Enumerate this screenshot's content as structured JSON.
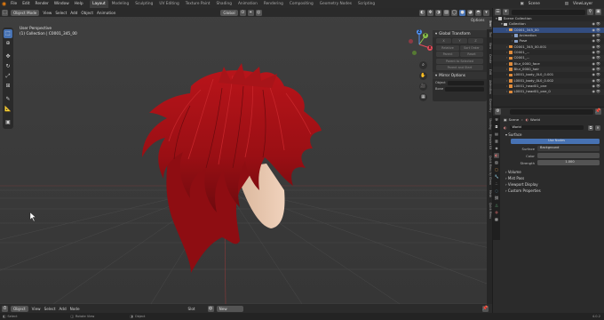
{
  "menu": {
    "items": [
      "File",
      "Edit",
      "Render",
      "Window",
      "Help"
    ],
    "workspaces": [
      "Layout",
      "Modeling",
      "Sculpting",
      "UV Editing",
      "Texture Paint",
      "Shading",
      "Animation",
      "Rendering",
      "Compositing",
      "Geometry Nodes",
      "Scripting"
    ],
    "active_workspace": "Layout",
    "scene_label": "Scene",
    "view_layer_label": "ViewLayer"
  },
  "viewport": {
    "mode": "Object Mode",
    "menus": [
      "View",
      "Select",
      "Add",
      "Object",
      "Animation"
    ],
    "orientation": "Global",
    "overlay_title": "User Perspective",
    "overlay_subtitle": "(1) Collection | C0001_345_00",
    "options_label": "Options",
    "footer": {
      "mode": "Object",
      "menus": [
        "View",
        "Select",
        "Add",
        "Node"
      ],
      "center_left": "Slot",
      "center_right": "New"
    }
  },
  "npanel": {
    "title": "Global Transform",
    "buttons": [
      "X",
      "Y",
      "Z",
      "Relative",
      "Sort Order",
      "Parent",
      "Reset",
      "Revert Parent"
    ],
    "buttons_disabled": [
      "Parent to Selected",
      "Parent and Start"
    ],
    "mirror_title": "Mirror Options",
    "fields": [
      {
        "label": "Object"
      },
      {
        "label": "Bone"
      }
    ],
    "tabs": [
      "Item",
      "Tool",
      "View",
      "Create",
      "Edit",
      "Animation",
      "Geometry",
      "Shading",
      "Blender Kit",
      "Quick Menu by Glenn",
      "Mesh",
      "Quick Menu",
      "Animation Nodes",
      "Rigging",
      "Item Objs",
      "Addons"
    ]
  },
  "outliner": {
    "rows": [
      {
        "label": "Scene Collection",
        "indent": 0,
        "color": "#c8c8c8"
      },
      {
        "label": "Collection",
        "indent": 1,
        "color": "#c8c8c8"
      },
      {
        "label": "C0001_345_00",
        "indent": 2,
        "color": "#e0a050",
        "selected": true
      },
      {
        "label": "Animation",
        "indent": 3,
        "color": "#88a0c8"
      },
      {
        "label": "Pose",
        "indent": 3,
        "color": "#88a0c8"
      },
      {
        "label": "C0001_345_00.001",
        "indent": 2,
        "color": "#e08c3c"
      },
      {
        "label": "C0001_...",
        "indent": 2,
        "color": "#e08c3c"
      },
      {
        "label": "C0001_...",
        "indent": 2,
        "color": "#e08c3c"
      },
      {
        "label": "Blur_0000_face",
        "indent": 2,
        "color": "#e08c3c"
      },
      {
        "label": "Blur_0000_hair",
        "indent": 2,
        "color": "#e08c3c"
      },
      {
        "label": "L0001_body_0L0_0.001",
        "indent": 2,
        "color": "#e08c3c"
      },
      {
        "label": "L0001_body_0L0_0.002",
        "indent": 2,
        "color": "#e08c3c"
      },
      {
        "label": "L0001_head01_one",
        "indent": 2,
        "color": "#e08c3c"
      },
      {
        "label": "L0001_head01_one_0",
        "indent": 2,
        "color": "#e08c3c"
      }
    ]
  },
  "properties": {
    "scene": "Scene",
    "world": "World",
    "world_datablock": "World",
    "surface_section": "Surface",
    "use_nodes_label": "Use Nodes",
    "surface_label": "Surface",
    "surface_value": "Background",
    "color_label": "Color",
    "strength_label": "Strength",
    "strength_value": "1.000",
    "sections": [
      "Volume",
      "Mist Pass",
      "Viewport Display",
      "Custom Properties"
    ]
  },
  "status": {
    "items": [
      "Select",
      "Rotate View",
      "Object"
    ],
    "version": "4.0.2"
  },
  "colors": {
    "accent": "#4772b3",
    "hair": "#9e1115",
    "skin": "#e6c6ad",
    "axis_x": "#e44b5a",
    "axis_y": "#8bc34a",
    "axis_z": "#4e8ff0"
  }
}
